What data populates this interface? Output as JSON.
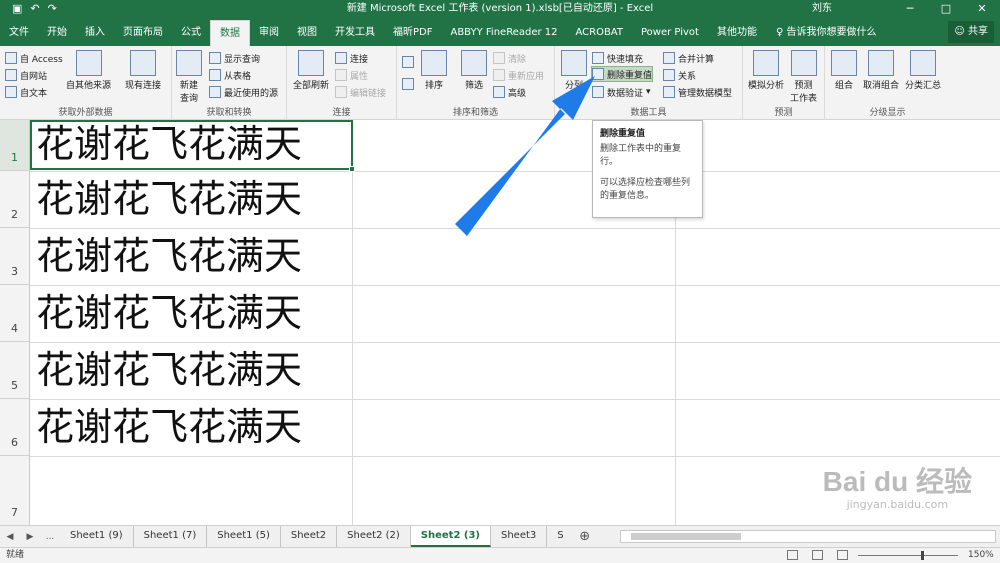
{
  "titlebar": {
    "title": "新建 Microsoft Excel 工作表 (version 1).xlsb[已自动还原]  -  Excel",
    "user": "刘东",
    "save_icon": "save-icon",
    "undo_icon": "undo-icon",
    "redo_icon": "redo-icon",
    "minimize": "─",
    "restore": "□",
    "close": "✕"
  },
  "tabs": [
    "文件",
    "开始",
    "插入",
    "页面布局",
    "公式",
    "数据",
    "审阅",
    "视图",
    "开发工具",
    "福昕PDF",
    "ABBYY FineReader 12",
    "ACROBAT",
    "Power Pivot",
    "其他功能"
  ],
  "active_tab": "数据",
  "tell_me": "告诉我你想要做什么",
  "share": "共享",
  "ribbon": {
    "get_external": {
      "label": "获取外部数据",
      "access": "自 Access",
      "web": "自网站",
      "text": "自文本",
      "other": "自其他来源",
      "existing": "现有连接"
    },
    "get_transform": {
      "label": "获取和转换",
      "new_query": "新建",
      "new_query_2": "查询",
      "show_queries": "显示查询",
      "from_table": "从表格",
      "recent_sources": "最近使用的源"
    },
    "connections": {
      "label": "连接",
      "refresh_all": "全部刷新",
      "connections": "连接",
      "properties": "属性",
      "edit_links": "编辑链接"
    },
    "sort_filter": {
      "label": "排序和筛选",
      "sort": "排序",
      "filter": "筛选",
      "clear": "清除",
      "reapply": "重新应用",
      "advanced": "高级"
    },
    "data_tools": {
      "label": "数据工具",
      "text_to_columns": "分列",
      "flash_fill": "快速填充",
      "remove_duplicates": "删除重复值",
      "data_validation": "数据验证",
      "consolidate": "合并计算",
      "relationships": "关系",
      "manage_model": "管理数据模型"
    },
    "forecast": {
      "label": "预测",
      "what_if": "模拟分析",
      "forecast_sheet": "预测",
      "forecast_sheet_2": "工作表"
    },
    "outline": {
      "label": "分级显示",
      "group": "组合",
      "ungroup": "取消组合",
      "subtotal": "分类汇总"
    }
  },
  "tooltip": {
    "title": "删除重复值",
    "line1": "删除工作表中的重复行。",
    "line2": "可以选择应检查哪些列的重复信息。"
  },
  "rows": [
    {
      "num": "1",
      "text": "花谢花飞花满天"
    },
    {
      "num": "2",
      "text": "花谢花飞花满天"
    },
    {
      "num": "3",
      "text": "花谢花飞花满天"
    },
    {
      "num": "4",
      "text": "花谢花飞花满天"
    },
    {
      "num": "5",
      "text": "花谢花飞花满天"
    },
    {
      "num": "6",
      "text": "花谢花飞花满天"
    },
    {
      "num": "7",
      "text": ""
    }
  ],
  "sheets": [
    "Sheet1 (9)",
    "Sheet1 (7)",
    "Sheet1 (5)",
    "Sheet2",
    "Sheet2 (2)",
    "Sheet2 (3)",
    "Sheet3",
    "S"
  ],
  "active_sheet": "Sheet2 (3)",
  "nav": {
    "prev": "◀",
    "next": "▶",
    "more": "...",
    "add": "⊕"
  },
  "status": {
    "ready": "就绪",
    "zoom": "150%"
  },
  "watermark": {
    "main": "Bai du 经验",
    "sub": "jingyan.baidu.com"
  },
  "colors": {
    "excel_green": "#217346",
    "arrow_blue": "#1e7be8"
  }
}
